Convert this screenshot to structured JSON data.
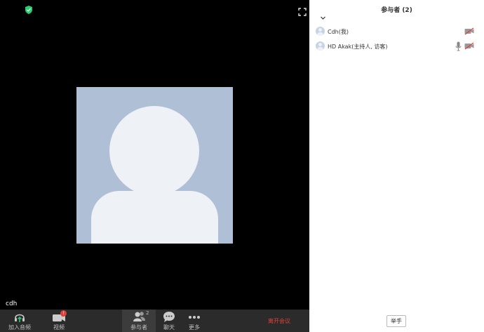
{
  "video": {
    "participant_name": "cdh"
  },
  "toolbar": {
    "audio_label": "加入音频",
    "video_label": "视频",
    "video_badge": "!",
    "participants_label": "参与者",
    "participants_count": "2",
    "chat_label": "聊天",
    "more_label": "更多",
    "leave_label": "离开会议"
  },
  "panel": {
    "title": "参与者 (2)",
    "participants": [
      {
        "name": "Cdh(我)"
      },
      {
        "name": "HD Akak(主持人, 访客)"
      }
    ],
    "raise_hand_label": "举手"
  },
  "colors": {
    "accent_green": "#2ecc71",
    "leave_red": "#e0403a",
    "avatar_bg": "#aebfd6"
  }
}
